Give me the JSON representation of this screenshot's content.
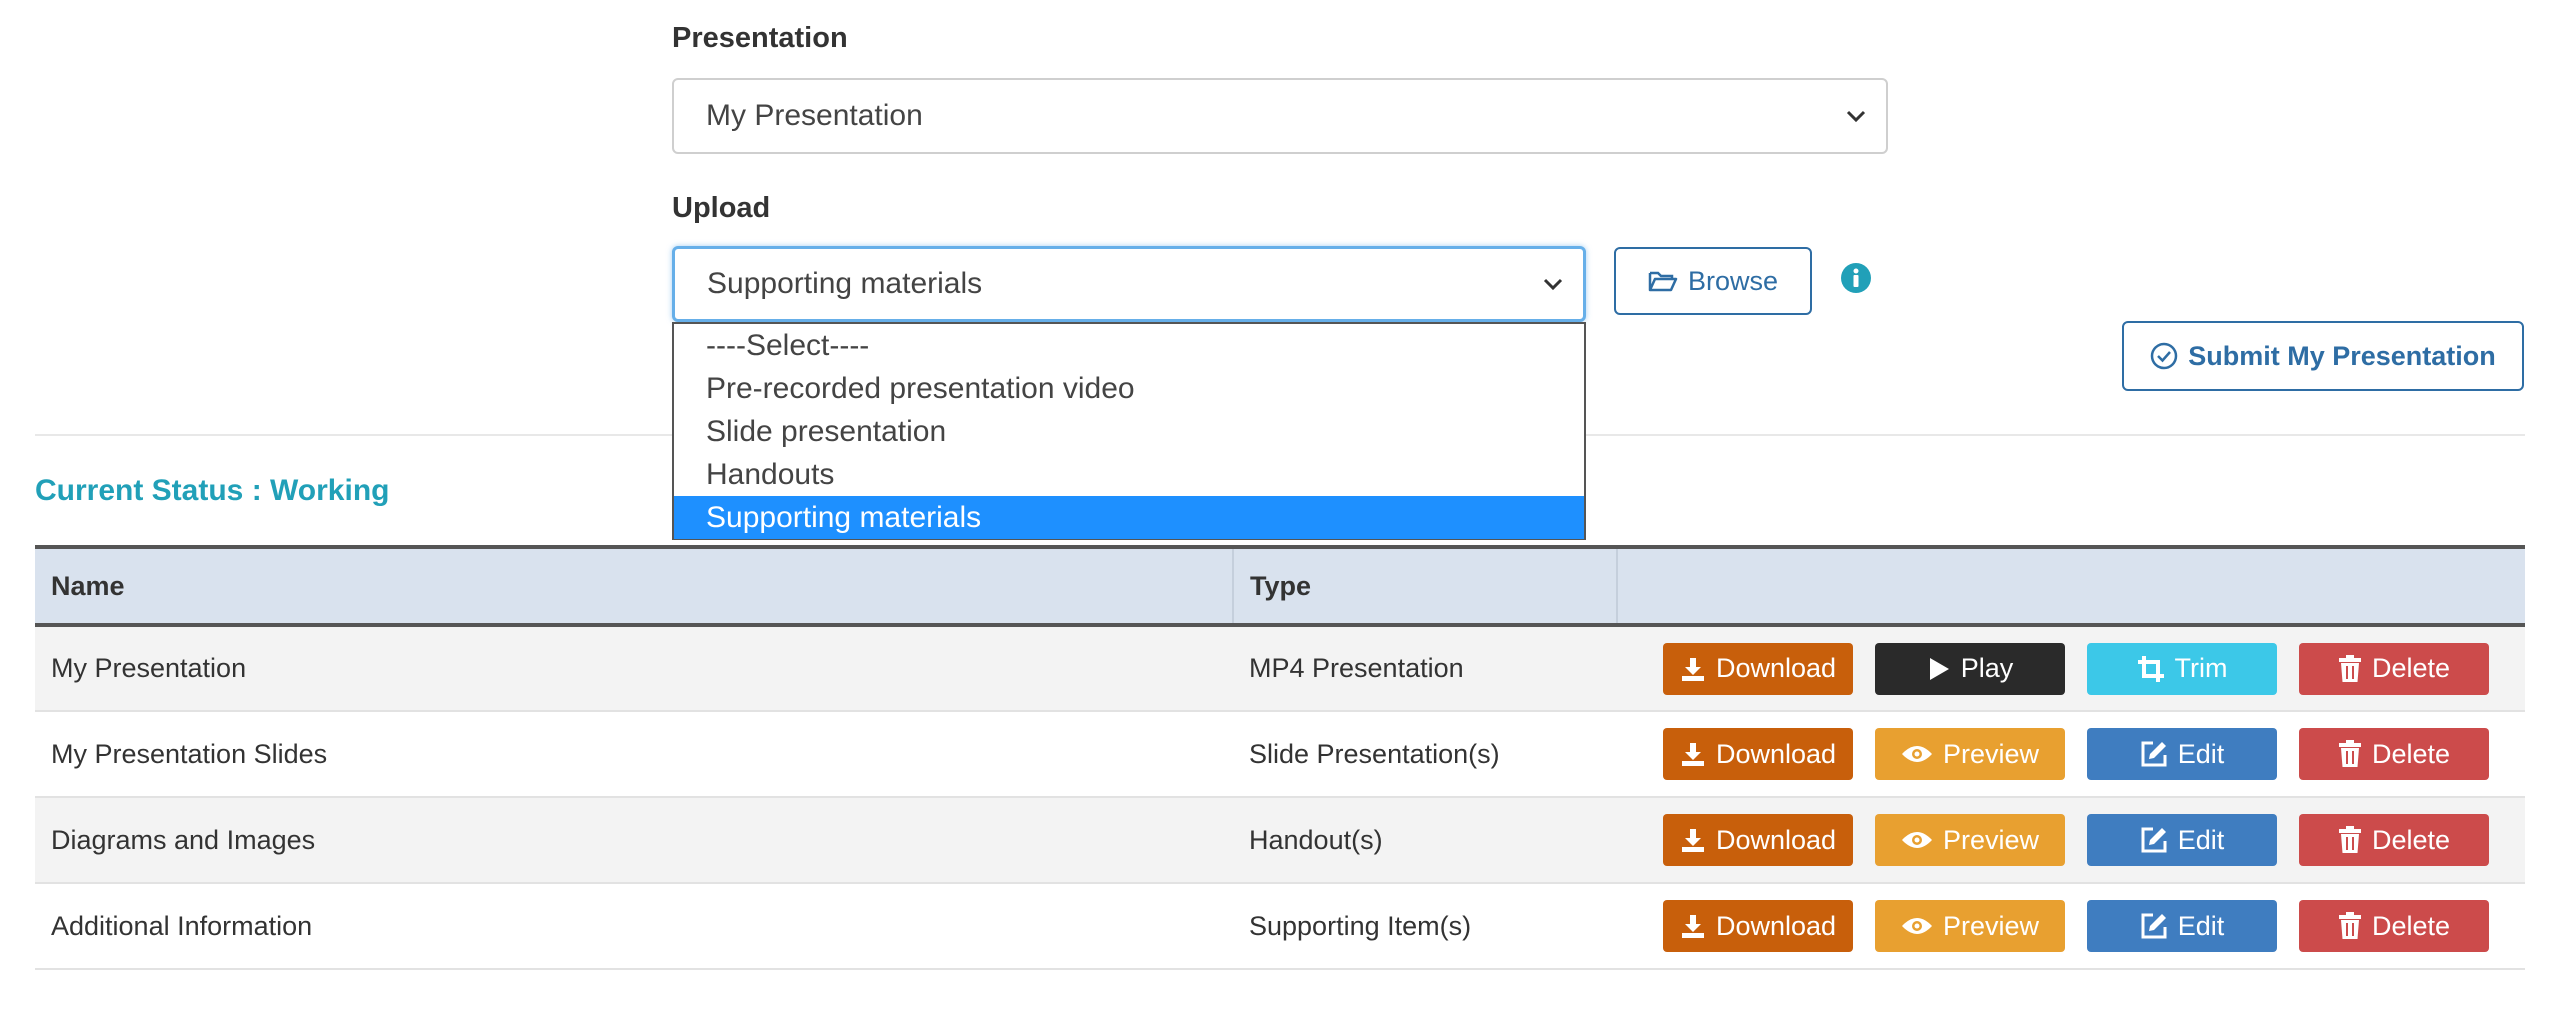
{
  "presentation": {
    "label": "Presentation",
    "selected": "My Presentation"
  },
  "upload": {
    "label": "Upload",
    "selected": "Supporting materials",
    "browse_label": "Browse",
    "options": [
      "----Select----",
      "Pre-recorded presentation video",
      "Slide presentation",
      "Handouts",
      "Supporting materials"
    ],
    "highlighted_index": 4
  },
  "submit_label": "Submit My Presentation",
  "status_text": "Current Status : Working",
  "table": {
    "headers": [
      "Name",
      "Type"
    ],
    "rows": [
      {
        "name": "My Presentation",
        "type": "MP4 Presentation",
        "actions": [
          "Download",
          "Play",
          "Trim",
          "Delete"
        ]
      },
      {
        "name": "My Presentation Slides",
        "type": "Slide Presentation(s)",
        "actions": [
          "Download",
          "Preview",
          "Edit",
          "Delete"
        ]
      },
      {
        "name": "Diagrams and Images",
        "type": "Handout(s)",
        "actions": [
          "Download",
          "Preview",
          "Edit",
          "Delete"
        ]
      },
      {
        "name": "Additional Information",
        "type": "Supporting Item(s)",
        "actions": [
          "Download",
          "Preview",
          "Edit",
          "Delete"
        ]
      }
    ]
  },
  "colors": {
    "download": "#c85f0b",
    "play": "#2a2a2a",
    "trim": "#3cc8e8",
    "preview": "#e8a030",
    "edit": "#3f7dc0",
    "delete": "#cc4b4b",
    "status": "#21a0b8",
    "accent": "#2e6da4",
    "dropdown_highlight": "#1e90ff"
  }
}
